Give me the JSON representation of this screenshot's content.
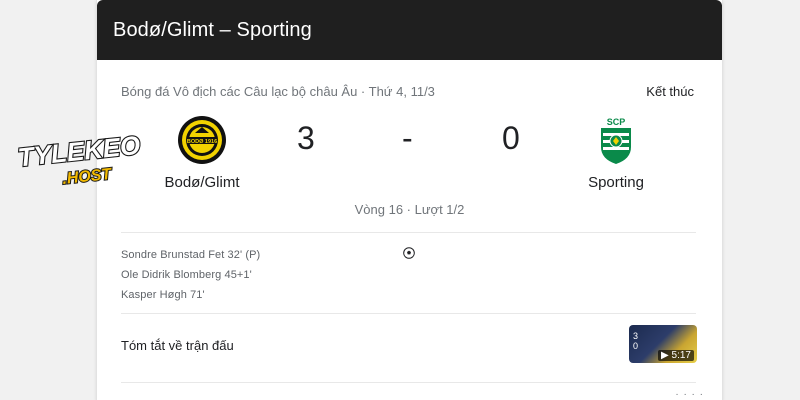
{
  "header": {
    "title": "Bodø/Glimt – Sporting"
  },
  "match": {
    "competition": "Bóng đá Vô địch các Câu lạc bộ châu Âu · Thứ 4, 11/3",
    "status": "Kết thúc",
    "home": {
      "name": "Bodø/Glimt",
      "score": "3",
      "logo_text": "BODØ 1916"
    },
    "away": {
      "name": "Sporting",
      "score": "0",
      "logo_text": "SCP"
    },
    "separator": "-",
    "round": "Vòng 16 · Lượt 1/2"
  },
  "scorers": [
    "Sondre Brunstad Fet 32' (P)",
    "Ole Didrik Blomberg 45+1'",
    "Kasper Høgh 71'"
  ],
  "summary": {
    "label": "Tóm tắt về trận đấu",
    "thumb_score_home": "3",
    "thumb_score_away": "0",
    "duration": "5:17"
  },
  "watermark": {
    "line1": "TYLEKEO",
    "line2": ".HOST"
  },
  "colors": {
    "header_bg": "#1f1f1f",
    "bodo_yellow": "#f2d200",
    "sporting_green": "#0a8a4a"
  },
  "icons": {
    "ball": "soccer-ball-icon",
    "play": "play-icon",
    "more": "more-dots-icon"
  }
}
